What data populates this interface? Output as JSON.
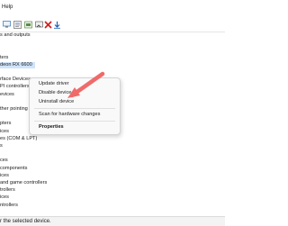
{
  "menu": {
    "help_label": "Help"
  },
  "toolbar": {
    "buttons": [
      {
        "icon": "monitor-icon"
      },
      {
        "icon": "properties-icon"
      },
      {
        "icon": "driver-update-icon"
      },
      {
        "icon": "disable-device-icon"
      },
      {
        "icon": "uninstall-x-icon"
      },
      {
        "icon": "scan-download-icon"
      }
    ]
  },
  "tree": {
    "rows": [
      {
        "text": "s and outputs"
      },
      {
        "text": ""
      },
      {
        "text": ""
      },
      {
        "text": "ters"
      },
      {
        "text": "deon RX 6600",
        "selected": true
      },
      {
        "text": ""
      },
      {
        "text": "rface Devices"
      },
      {
        "text": "PI controllers"
      },
      {
        "text": "evices"
      },
      {
        "text": ""
      },
      {
        "text": "ther pointing de"
      },
      {
        "text": ""
      },
      {
        "text": "pters"
      },
      {
        "text": "ices"
      },
      {
        "text": "es (COM & LPT)"
      },
      {
        "text": "s"
      },
      {
        "text": ""
      },
      {
        "text": "ces"
      },
      {
        "text": "components"
      },
      {
        "text": "ices"
      },
      {
        "text": "and game controllers"
      },
      {
        "text": "trollers"
      },
      {
        "text": "ices"
      },
      {
        "text": "ntrollers"
      }
    ]
  },
  "context_menu": {
    "items": [
      {
        "label": "Update driver"
      },
      {
        "label": "Disable device"
      },
      {
        "label": "Uninstall device"
      },
      {
        "label": "Scan for hardware changes"
      },
      {
        "label": "Properties",
        "bold": true
      }
    ]
  },
  "status": {
    "text": "r the selected device."
  },
  "colors": {
    "selection": "#cfe3fb",
    "arrow": "#f06a6a",
    "accent": "#2b6cd4"
  }
}
